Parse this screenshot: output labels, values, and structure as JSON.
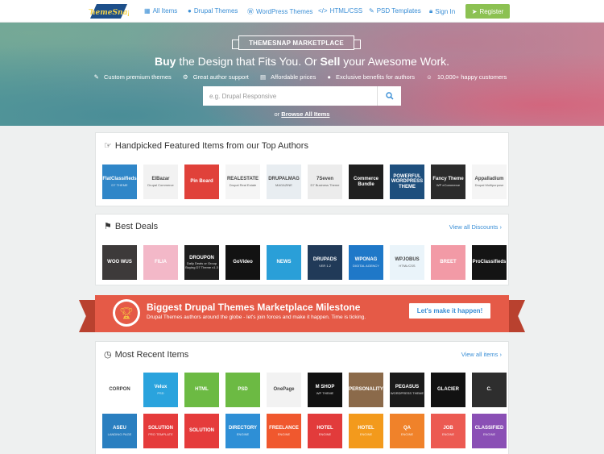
{
  "nav": {
    "logo_text": "ThemeSnap",
    "links": [
      {
        "icon": "grid-icon",
        "label": "All Items"
      },
      {
        "icon": "drupal-icon",
        "label": "Drupal Themes"
      },
      {
        "icon": "wordpress-icon",
        "label": "WordPress Themes"
      },
      {
        "icon": "code-icon",
        "label": "HTML/CSS"
      },
      {
        "icon": "brush-icon",
        "label": "PSD Templates"
      },
      {
        "icon": "lock-icon",
        "label": "Sign In"
      }
    ],
    "register": "Register"
  },
  "hero": {
    "ribbon": "THEMESNAP MARKETPLACE",
    "headline_buy": "Buy",
    "headline_mid": " the Design that Fits You. Or ",
    "headline_sell": "Sell",
    "headline_end": " your Awesome Work.",
    "features": [
      "Custom premium themes",
      "Great author support",
      "Affordable prices",
      "Exclusive benefits for authors",
      "10,000+ happy customers"
    ],
    "search_placeholder": "e.g. Drupal Responsive",
    "browse_prefix": "or",
    "browse_link": "Browse All Items"
  },
  "featured": {
    "title": "Handpicked Featured Items from our Top Authors",
    "items": [
      {
        "name": "FlatClassifieds",
        "sub": "D7 THEME",
        "bg": "#2f86c8",
        "light": false
      },
      {
        "name": "ElBazar",
        "sub": "Drupal Commerce",
        "bg": "#f2f2f2",
        "light": true
      },
      {
        "name": "Pin Board",
        "sub": "",
        "bg": "#e0413a",
        "light": false
      },
      {
        "name": "REALESTATE",
        "sub": "Drupal Real Estate",
        "bg": "#f5f5f5",
        "light": true
      },
      {
        "name": "DRUPALMAG",
        "sub": "MAGAZINE",
        "bg": "#e8edf1",
        "light": true
      },
      {
        "name": "7Seven",
        "sub": "D7 Business Theme",
        "bg": "#ececec",
        "light": true
      },
      {
        "name": "Commerce Bundle",
        "sub": "",
        "bg": "#1f1f1f",
        "light": false
      },
      {
        "name": "POWERFUL WORDPRESS THEME",
        "sub": "",
        "bg": "#1e4f7d",
        "light": false
      },
      {
        "name": "Fancy Theme",
        "sub": "WP eCommerce",
        "bg": "#2b2b2b",
        "light": false
      },
      {
        "name": "Appalladium",
        "sub": "Drupal Multipurpose",
        "bg": "#f5f5f5",
        "light": true
      }
    ]
  },
  "deals": {
    "title": "Best Deals",
    "link": "View all Discounts ›",
    "items": [
      {
        "name": "WOO WUS",
        "sub": "",
        "bg": "#3d3a3a",
        "light": false
      },
      {
        "name": "FILIA",
        "sub": "",
        "bg": "#f3b8c8",
        "light": false
      },
      {
        "name": "DROUPON",
        "sub": "Daily Deals or Group Buying D7 Theme v1.3",
        "bg": "#1e1e1e",
        "light": false
      },
      {
        "name": "GoVideo",
        "sub": "",
        "bg": "#121212",
        "light": false
      },
      {
        "name": "NEWS",
        "sub": "",
        "bg": "#2a9fd8",
        "light": false
      },
      {
        "name": "DRUPADS",
        "sub": "VER 1.2",
        "bg": "#213a58",
        "light": false
      },
      {
        "name": "WPONAG",
        "sub": "DIGITAL AGENCY",
        "bg": "#1f78c8",
        "light": false
      },
      {
        "name": "WPJOBUS",
        "sub": "HTML/CSS",
        "bg": "#eaf4fa",
        "light": true
      },
      {
        "name": "BREET",
        "sub": "",
        "bg": "#f29aa6",
        "light": false
      },
      {
        "name": "ProClassifieds",
        "sub": "",
        "bg": "#141414",
        "light": false
      }
    ]
  },
  "banner": {
    "title": "Biggest Drupal Themes Marketplace Milestone",
    "subtitle": "Drupal Themes authors around the globe - let's join forces and make it happen. Time is ticking.",
    "button": "Let's make it happen!"
  },
  "recent": {
    "title": "Most Recent Items",
    "link": "View all items ›",
    "row1": [
      {
        "name": "CORPON",
        "sub": "",
        "bg": "#ffffff",
        "light": true
      },
      {
        "name": "Velux",
        "sub": "PSD",
        "bg": "#2aa3dd",
        "light": false
      },
      {
        "name": "HTML",
        "sub": "",
        "bg": "#6cba43",
        "light": false
      },
      {
        "name": "PSD",
        "sub": "",
        "bg": "#6cba43",
        "light": false
      },
      {
        "name": "OnePage",
        "sub": "",
        "bg": "#f2f2f2",
        "light": true
      },
      {
        "name": "M SHOP",
        "sub": "WP THEME",
        "bg": "#111111",
        "light": false
      },
      {
        "name": "PERSONALITY",
        "sub": "",
        "bg": "#8b6a4a",
        "light": false
      },
      {
        "name": "PEGASUS",
        "sub": "WORDPRESS THEME",
        "bg": "#1b1b1b",
        "light": false
      },
      {
        "name": "GLACIER",
        "sub": "",
        "bg": "#121212",
        "light": false
      },
      {
        "name": "C.",
        "sub": "",
        "bg": "#2e2e2e",
        "light": false
      }
    ],
    "row2": [
      {
        "name": "ASEU",
        "sub": "LANDING PAGE",
        "bg": "#2a7fc0",
        "light": false
      },
      {
        "name": "SOLUTION",
        "sub": "PRO TEMPLATE",
        "bg": "#e53b3b",
        "light": false
      },
      {
        "name": "SOLUTION",
        "sub": "",
        "bg": "#e53b3b",
        "light": false
      },
      {
        "name": "DIRECTORY",
        "sub": "ENGINE",
        "bg": "#2e8fd6",
        "light": false
      },
      {
        "name": "FREELANCE",
        "sub": "ENGINE",
        "bg": "#f0582e",
        "light": false
      },
      {
        "name": "HOTEL",
        "sub": "ENGINE",
        "bg": "#e23b3b",
        "light": false
      },
      {
        "name": "HOTEL",
        "sub": "ENGINE",
        "bg": "#f39a1c",
        "light": false
      },
      {
        "name": "QA",
        "sub": "ENGINE",
        "bg": "#f0822a",
        "light": false
      },
      {
        "name": "JOB",
        "sub": "ENGINE",
        "bg": "#ec5a52",
        "light": false
      },
      {
        "name": "CLASSIFIED",
        "sub": "ENGINE",
        "bg": "#8a4fb5",
        "light": false
      }
    ]
  }
}
